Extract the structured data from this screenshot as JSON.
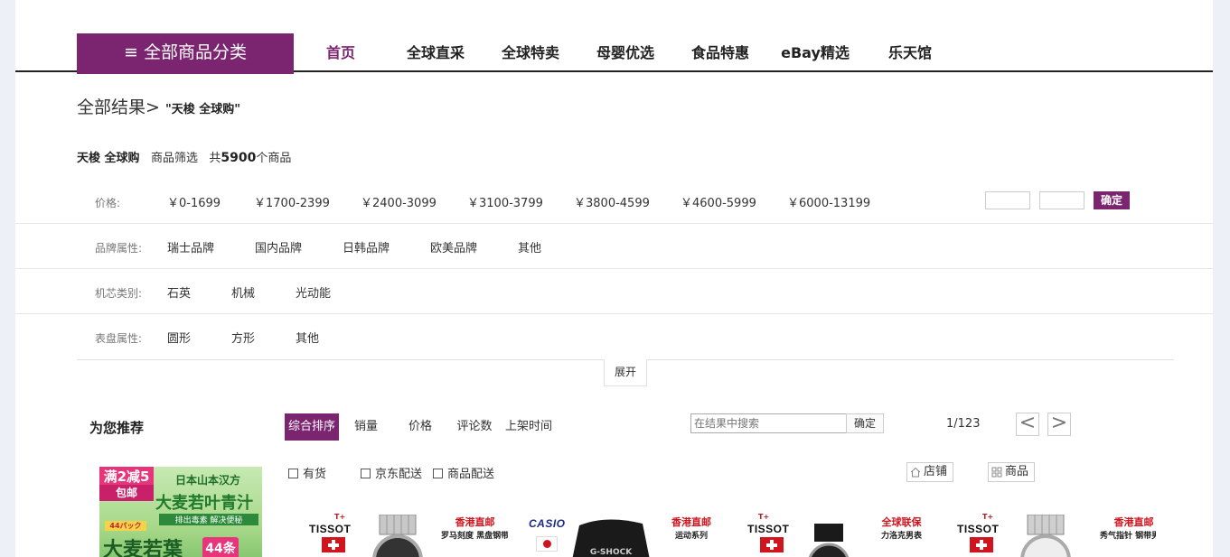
{
  "nav": {
    "category_label": "≡ 全部商品分类",
    "items": [
      "首页",
      "全球直采",
      "全球特卖",
      "母婴优选",
      "食品特惠",
      "eBay精选",
      "乐天馆"
    ]
  },
  "breadcrumb": {
    "root": "全部结果",
    "separator": ">",
    "query": "\"天梭 全球购\""
  },
  "summary": {
    "keyword": "天梭 全球购",
    "filter_label": "商品筛选",
    "count_prefix": "共",
    "count": "5900",
    "count_suffix": "个商品"
  },
  "filters": {
    "price": {
      "label": "价格:",
      "options": [
        "￥0-1699",
        "￥1700-2399",
        "￥2400-3099",
        "￥3100-3799",
        "￥3800-4599",
        "￥4600-5999",
        "￥6000-13199"
      ],
      "confirm": "确定"
    },
    "brand": {
      "label": "品牌属性:",
      "options": [
        "瑞士品牌",
        "国内品牌",
        "日韩品牌",
        "欧美品牌",
        "其他"
      ]
    },
    "movement": {
      "label": "机芯类别:",
      "options": [
        "石英",
        "机械",
        "光动能"
      ]
    },
    "dial": {
      "label": "表盘属性:",
      "options": [
        "圆形",
        "方形",
        "其他"
      ]
    },
    "expand": "展开"
  },
  "recommend": {
    "title": "为您推荐"
  },
  "sort": {
    "options": [
      "综合排序",
      "销量",
      "价格",
      "评论数",
      "上架时间"
    ]
  },
  "search": {
    "placeholder": "在结果中搜索",
    "button": "确定"
  },
  "pager": {
    "text": "1/123",
    "prev": "<",
    "next": ">"
  },
  "checks": [
    "有货",
    "京东配送",
    "商品配送"
  ],
  "view_toggle": {
    "store": "店铺",
    "product": "商品"
  },
  "banner": {
    "tag_top": "满2减5",
    "tag_bottom": "包邮",
    "line1": "日本山本汉方",
    "line2": "大麦若叶青汁",
    "line3": "排出毒素 解决便秘",
    "badge": "44パック",
    "line4": "大麦若葉",
    "count": "44条"
  },
  "products": [
    {
      "brand": "TISSOT",
      "flag": "ch",
      "tag_a": "香港直邮",
      "tag_b": "罗马刻度 黑盘钢带"
    },
    {
      "brand": "CASIO",
      "flag": "jp",
      "tag_a": "香港直邮",
      "tag_b": "运动系列"
    },
    {
      "brand": "TISSOT",
      "flag": "ch",
      "tag_a": "全球联保",
      "tag_b": "力洛克男表"
    },
    {
      "brand": "TISSOT",
      "flag": "ch",
      "tag_a": "香港直邮",
      "tag_b": "秀气指针 钢带男表"
    }
  ],
  "colors": {
    "accent": "#7b2571",
    "background": "#eef0f8"
  }
}
